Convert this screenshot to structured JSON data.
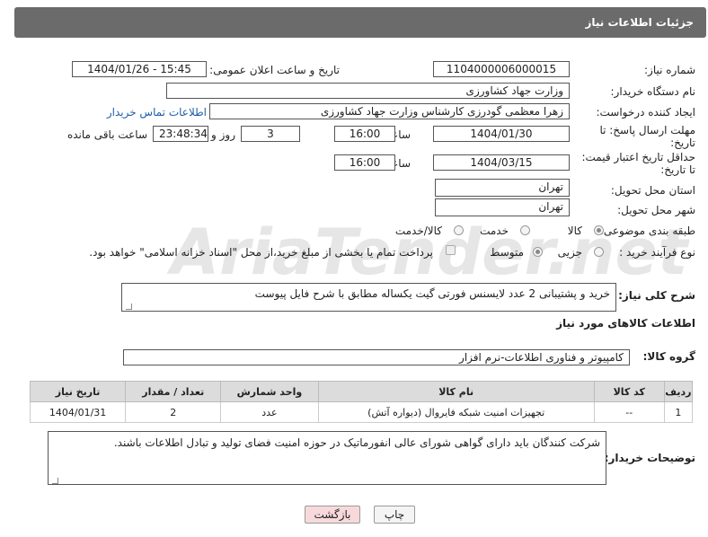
{
  "header": {
    "title": "جزئیات اطلاعات نیاز"
  },
  "fields": {
    "need_number_label": "شماره نیاز:",
    "need_number": "1104000006000015",
    "announce_label": "تاریخ و ساعت اعلان عمومی:",
    "announce_value": "1404/01/26 - 15:45",
    "buyer_org_label": "نام دستگاه خریدار:",
    "buyer_org": "وزارت جهاد کشاورزی",
    "creator_label": "ایجاد کننده درخواست:",
    "creator": "زهرا معظمی گودرزی کارشناس وزارت جهاد کشاورزی",
    "contact_link": "اطلاعات تماس خریدار",
    "reply_deadline_label_1": "مهلت ارسال پاسخ: تا",
    "reply_deadline_label_2": "تاریخ:",
    "reply_date": "1404/01/30",
    "time_label": "ساعت",
    "reply_time": "16:00",
    "days_value": "3",
    "days_label": "روز و",
    "remaining_time": "23:48:34",
    "remaining_label": "ساعت باقی مانده",
    "price_validity_label_1": "حداقل تاریخ اعتبار قیمت:",
    "price_validity_label_2": "تا تاریخ:",
    "validity_date": "1404/03/15",
    "validity_time": "16:00",
    "province_label": "استان محل تحویل:",
    "province": "تهران",
    "city_label": "شهر محل تحویل:",
    "city": "تهران",
    "category_label": "طبقه بندی موضوعی:",
    "category_options": [
      "کالا",
      "خدمت",
      "کالا/خدمت"
    ],
    "process_label": "نوع فرآیند خرید :",
    "process_options": [
      "جزیی",
      "متوسط"
    ],
    "payment_note": "پرداخت تمام یا بخشی از مبلغ خرید،از محل \"اسناد خزانه اسلامی\" خواهد بود.",
    "description_label": "شرح کلی نیاز:",
    "description": "خرید و پشتیبانی 2 عدد لایسنس فورتی گیت یکساله مطابق با شرح فایل پیوست",
    "goods_info_title": "اطلاعات کالاهای مورد نیاز",
    "goods_group_label": "گروه کالا:",
    "goods_group": "کامپیوتر و فناوری اطلاعات-نرم افزار",
    "buyer_notes_label": "توضیحات خریدار:",
    "buyer_notes": "شرکت کنندگان باید دارای گواهی شورای عالی انفورماتیک در حوزه امنیت فضای تولید و تبادل اطلاعات باشند."
  },
  "table": {
    "headers": [
      "ردیف",
      "کد کالا",
      "نام کالا",
      "واحد شمارش",
      "تعداد / مقدار",
      "تاریخ نیاز"
    ],
    "rows": [
      [
        "1",
        "--",
        "تجهیزات امنیت شبکه فایروال (دیواره آتش)",
        "عدد",
        "2",
        "1404/01/31"
      ]
    ]
  },
  "buttons": {
    "print": "چاپ",
    "back": "بازگشت"
  },
  "watermark": "AriaTender.net",
  "colors": {
    "header_bg": "#6b6b6b",
    "link": "#1f5fa8",
    "back_button_bg": "#f7d9dc",
    "table_header_bg": "#dcdcdc"
  }
}
